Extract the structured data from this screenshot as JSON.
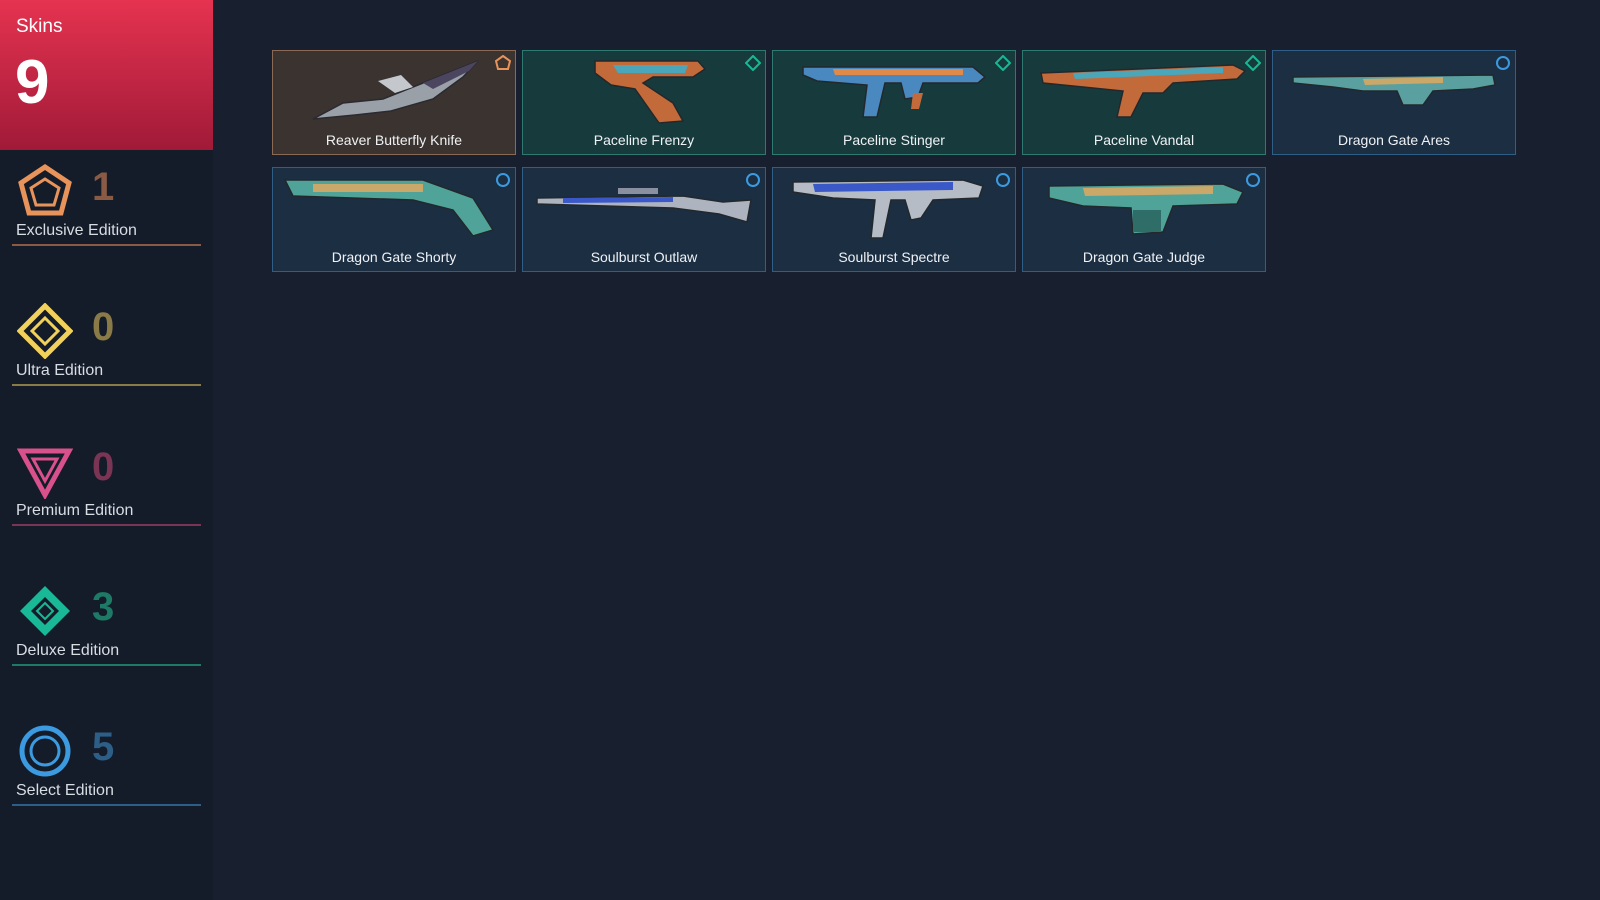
{
  "header": {
    "title": "Skins",
    "count": "9"
  },
  "tiers": [
    {
      "name": "Exclusive Edition",
      "count": "1",
      "color": "#e8935a",
      "count_color": "#8a5a45",
      "icon": "exclusive-edition-icon"
    },
    {
      "name": "Ultra Edition",
      "count": "0",
      "color": "#f2d15b",
      "count_color": "#8a7a48",
      "icon": "ultra-edition-icon"
    },
    {
      "name": "Premium Edition",
      "count": "0",
      "color": "#d8508c",
      "count_color": "#7a3555",
      "icon": "premium-edition-icon"
    },
    {
      "name": "Deluxe Edition",
      "count": "3",
      "color": "#19b896",
      "count_color": "#1c7a66",
      "icon": "deluxe-edition-icon"
    },
    {
      "name": "Select Edition",
      "count": "5",
      "color": "#3c9ae0",
      "count_color": "#2c5e88",
      "icon": "select-edition-icon"
    }
  ],
  "skins": [
    {
      "name": "Reaver Butterfly Knife",
      "tier": "exclusive"
    },
    {
      "name": "Paceline Frenzy",
      "tier": "deluxe"
    },
    {
      "name": "Paceline Stinger",
      "tier": "deluxe"
    },
    {
      "name": "Paceline Vandal",
      "tier": "deluxe"
    },
    {
      "name": "Dragon Gate Ares",
      "tier": "select"
    },
    {
      "name": "Dragon Gate Shorty",
      "tier": "select"
    },
    {
      "name": "Soulburst Outlaw",
      "tier": "select"
    },
    {
      "name": "Soulburst Spectre",
      "tier": "select"
    },
    {
      "name": "Dragon Gate Judge",
      "tier": "select"
    }
  ],
  "colors": {
    "accent": "#e53350",
    "card_exclusive": "#3a3330",
    "card_deluxe": "#173b3c",
    "card_select": "#1b2e42"
  }
}
